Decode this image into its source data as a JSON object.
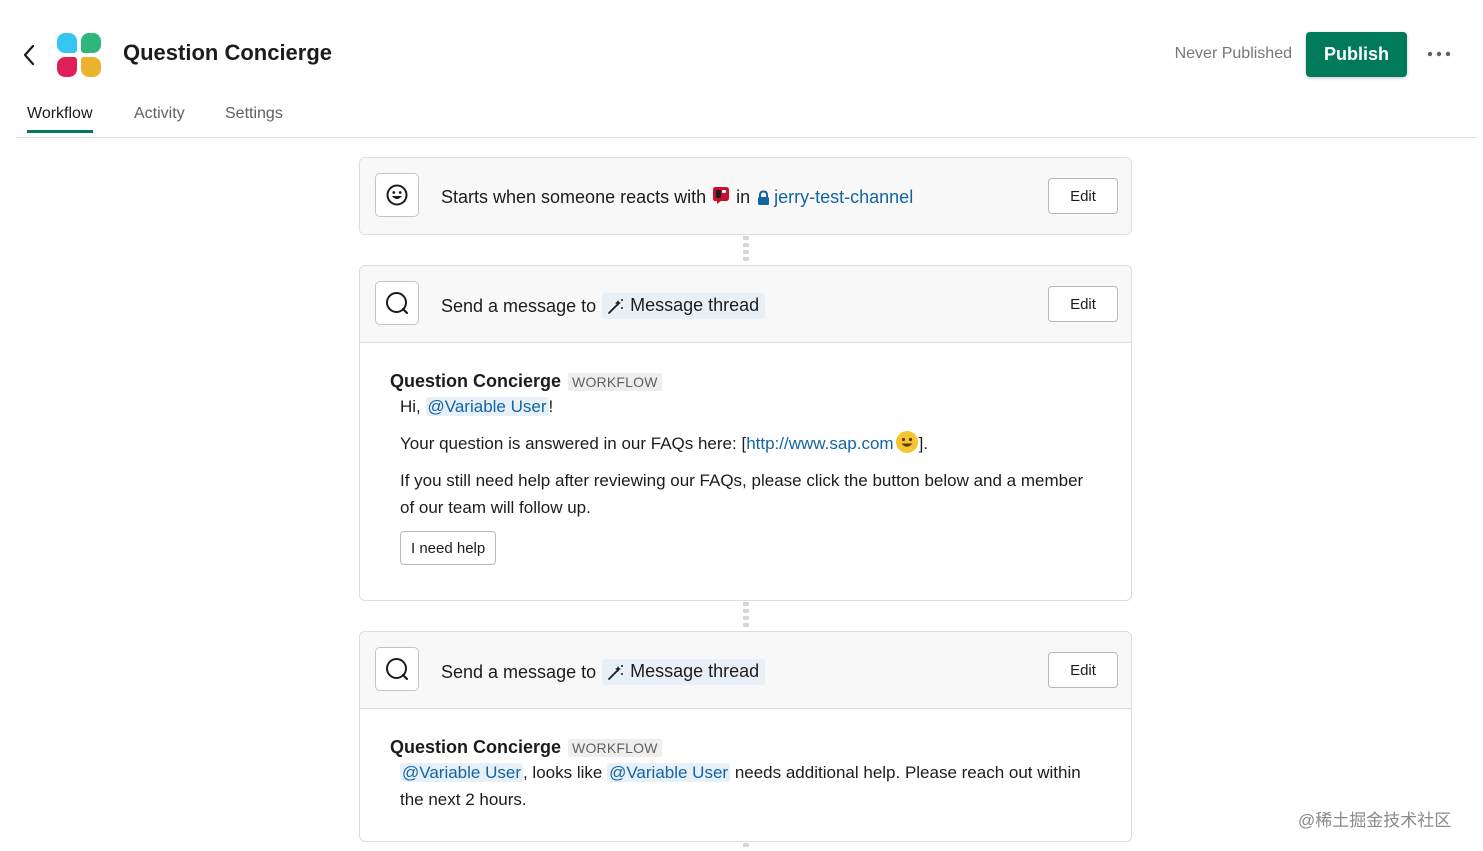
{
  "header": {
    "title": "Question Concierge",
    "status": "Never Published",
    "publish_label": "Publish",
    "logo_colors": [
      "#36c5f0",
      "#2eb67d",
      "#e01e5a",
      "#ecb22e"
    ],
    "accent_color": "#007a5a"
  },
  "tabs": [
    {
      "label": "Workflow",
      "active": true
    },
    {
      "label": "Activity",
      "active": false
    },
    {
      "label": "Settings",
      "active": false
    }
  ],
  "trigger": {
    "text": "Starts when someone reacts with",
    "in_text": "in",
    "channel": "jerry-test-channel",
    "edit_label": "Edit",
    "icon": "emoji-icon"
  },
  "steps": [
    {
      "prefix": "Send a message to",
      "target": "Message thread",
      "edit_label": "Edit",
      "icon": "search-icon",
      "sender": "Question Concierge",
      "badge": "WORKFLOW",
      "greeting": "Hi,",
      "mention": "@Variable User",
      "greeting_suffix": "!",
      "line2_prefix": "Your question is answered in our  FAQs here: [",
      "line2_link": "http://www.sap.com",
      "line2_suffix": "].",
      "line3": "If you still need help after reviewing our FAQs, please click the button below and a member of our team will follow up.",
      "button_label": "I need help"
    },
    {
      "prefix": "Send a message to",
      "target": "Message thread",
      "edit_label": "Edit",
      "icon": "search-icon",
      "sender": "Question Concierge",
      "badge": "WORKFLOW",
      "mention1": "@Variable User",
      "mid": ", looks like",
      "mention2": "@Variable User",
      "suffix": "needs additional help. Please reach out within the next 2 hours."
    }
  ],
  "watermark": "@稀土掘金技术社区"
}
